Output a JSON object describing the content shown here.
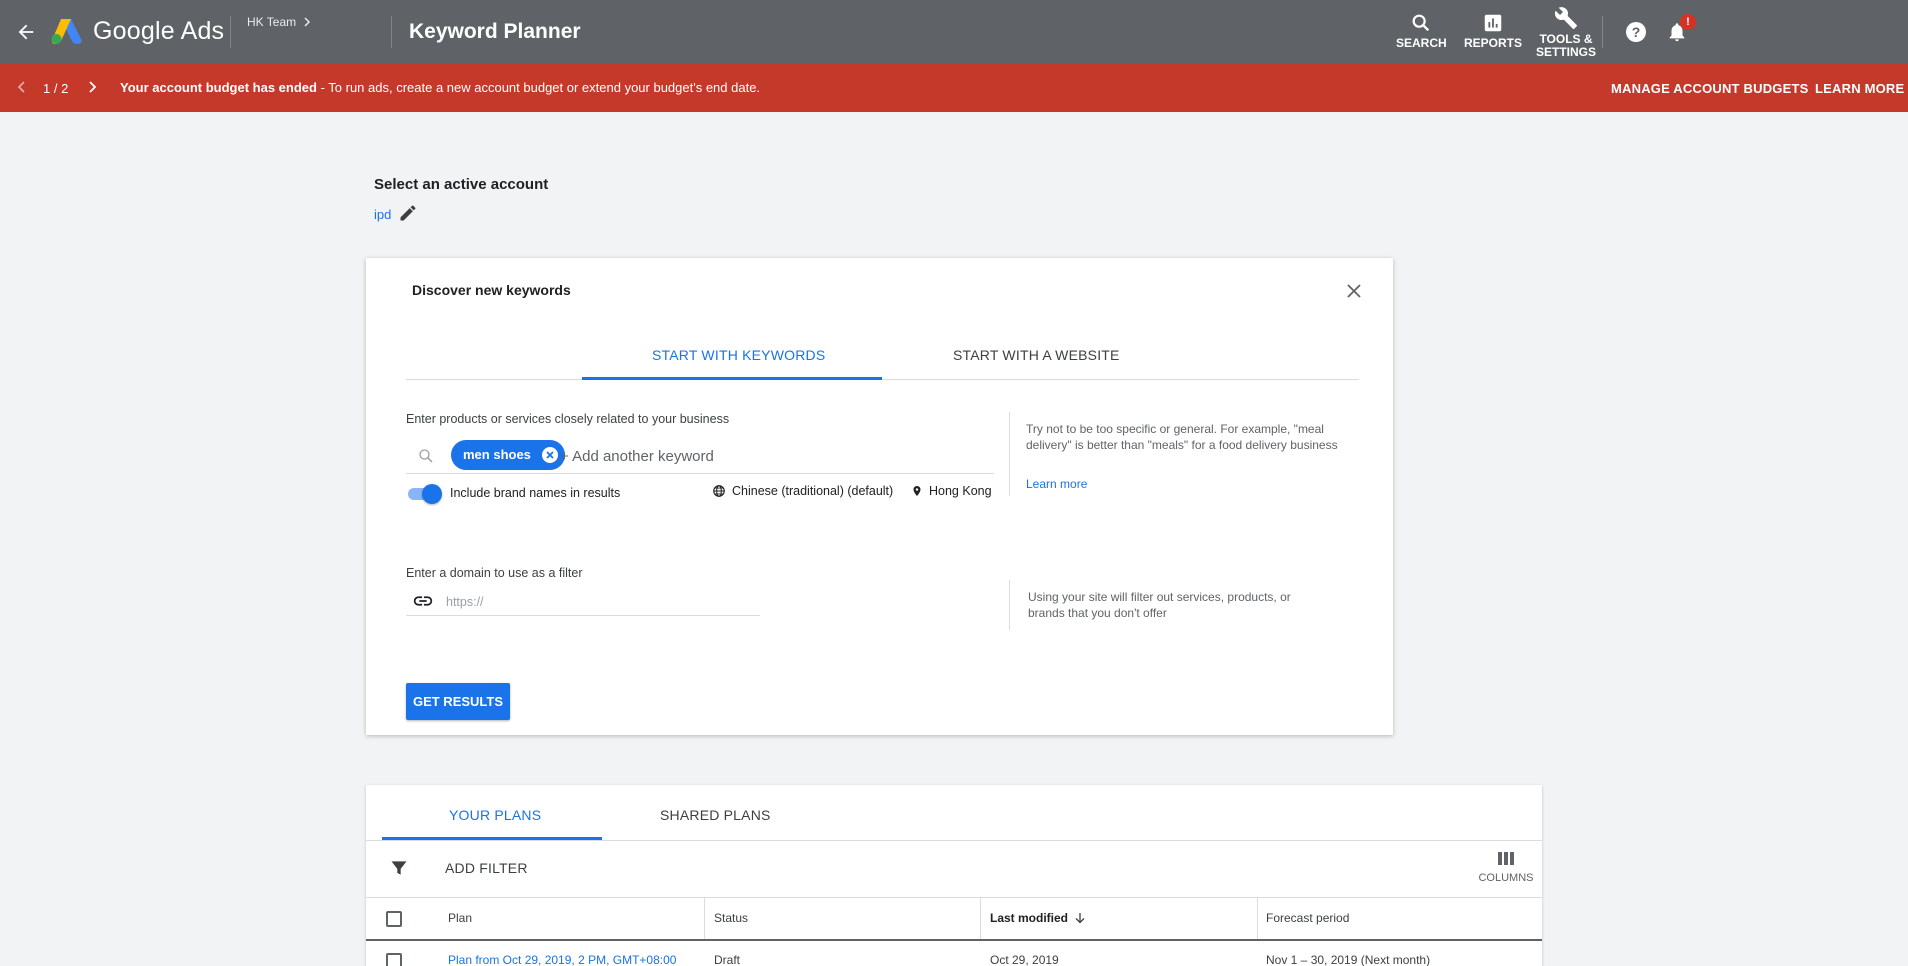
{
  "header": {
    "brand": "Google Ads",
    "account": "HK Team",
    "title": "Keyword Planner",
    "tools": {
      "search": "SEARCH",
      "reports": "REPORTS",
      "tools_line1": "TOOLS &",
      "tools_line2": "SETTINGS"
    },
    "notification_badge": "!"
  },
  "banner": {
    "count": "1 / 2",
    "message_bold": "Your account budget has ended",
    "message_rest": " - To run ads, create a new account budget or extend your budget's end date.",
    "manage_label": "MANAGE ACCOUNT BUDGETS",
    "learn_label": "LEARN MORE",
    "color": "#c5392a"
  },
  "account_select": {
    "heading": "Select an active account",
    "account_name": "ipd"
  },
  "discover": {
    "title": "Discover new keywords",
    "tabs": [
      {
        "label": "START WITH KEYWORDS",
        "active": true
      },
      {
        "label": "START WITH A WEBSITE",
        "active": false
      }
    ],
    "keywords_label": "Enter products or services closely related to your business",
    "chips": [
      "men shoes"
    ],
    "keyword_placeholder": "+ Add another keyword",
    "brand_toggle_label": "Include brand names in results",
    "brand_toggle_on": true,
    "language": "Chinese (traditional) (default)",
    "location": "Hong Kong",
    "hint_keywords": "Try not to be too specific or general. For example, \"meal delivery\" is better than \"meals\" for a food delivery business",
    "learn_more": "Learn more",
    "domain_label": "Enter a domain to use as a filter",
    "domain_placeholder": "https://",
    "hint_domain": "Using your site will filter out services, products, or brands that you don't offer",
    "get_results": "GET RESULTS"
  },
  "plans": {
    "tabs": [
      {
        "label": "YOUR PLANS",
        "active": true
      },
      {
        "label": "SHARED PLANS",
        "active": false
      }
    ],
    "add_filter": "ADD FILTER",
    "columns_label": "COLUMNS",
    "headers": {
      "plan": "Plan",
      "status": "Status",
      "modified": "Last modified",
      "forecast": "Forecast period"
    },
    "rows": [
      {
        "plan": "Plan from Oct 29, 2019, 2 PM, GMT+08:00",
        "status": "Draft",
        "modified": "Oct 29, 2019",
        "forecast": "Nov 1 – 30, 2019 (Next month)"
      }
    ]
  },
  "colors": {
    "header_bg": "#5f6368",
    "accent": "#1a73e8",
    "page_bg": "#f1f3f4"
  }
}
